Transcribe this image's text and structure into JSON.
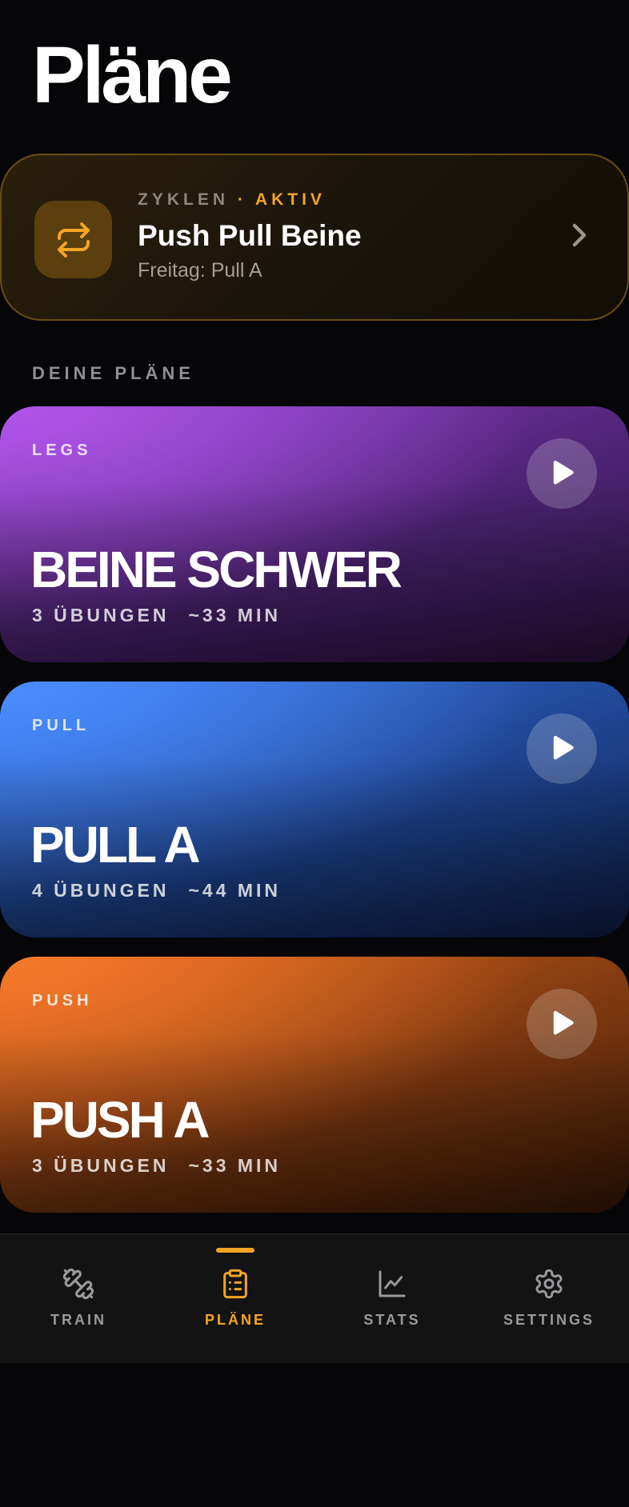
{
  "page": {
    "title": "Pläne"
  },
  "cycle": {
    "eyebrow_label": "ZYKLEN",
    "eyebrow_separator": "·",
    "status": "AKTIV",
    "title": "Push Pull Beine",
    "subtitle": "Freitag: Pull A",
    "icon": "repeat-icon",
    "accent_color": "#f5a524"
  },
  "section": {
    "label": "DEINE PLÄNE"
  },
  "plans": [
    {
      "tag": "LEGS",
      "title": "BEINE SCHWER",
      "exercises": "3 ÜBUNGEN",
      "duration": "~33 MIN",
      "color": "#a04de0"
    },
    {
      "tag": "PULL",
      "title": "PULL A",
      "exercises": "4 ÜBUNGEN",
      "duration": "~44 MIN",
      "color": "#3a74e0"
    },
    {
      "tag": "PUSH",
      "title": "PUSH A",
      "exercises": "3 ÜBUNGEN",
      "duration": "~33 MIN",
      "color": "#e0681e"
    }
  ],
  "nav": {
    "items": [
      {
        "label": "TRAIN",
        "icon": "dumbbell-icon",
        "active": false
      },
      {
        "label": "PLÄNE",
        "icon": "clipboard-icon",
        "active": true
      },
      {
        "label": "STATS",
        "icon": "chart-icon",
        "active": false
      },
      {
        "label": "SETTINGS",
        "icon": "gear-icon",
        "active": false
      }
    ]
  }
}
